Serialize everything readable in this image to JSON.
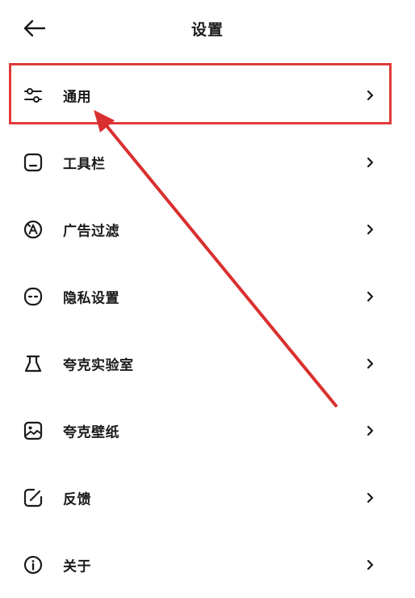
{
  "header": {
    "title": "设置",
    "back_icon": "arrow-left-icon"
  },
  "menu": {
    "items": [
      {
        "label": "通用",
        "icon": "sliders-icon"
      },
      {
        "label": "工具栏",
        "icon": "toolbar-icon"
      },
      {
        "label": "广告过滤",
        "icon": "ad-filter-icon"
      },
      {
        "label": "隐私设置",
        "icon": "privacy-icon"
      },
      {
        "label": "夸克实验室",
        "icon": "flask-icon"
      },
      {
        "label": "夸克壁纸",
        "icon": "wallpaper-icon"
      },
      {
        "label": "反馈",
        "icon": "feedback-icon"
      },
      {
        "label": "关于",
        "icon": "info-icon"
      }
    ]
  },
  "annotation": {
    "highlight_color": "#e03a3a",
    "arrow_color": "#d9302f"
  }
}
